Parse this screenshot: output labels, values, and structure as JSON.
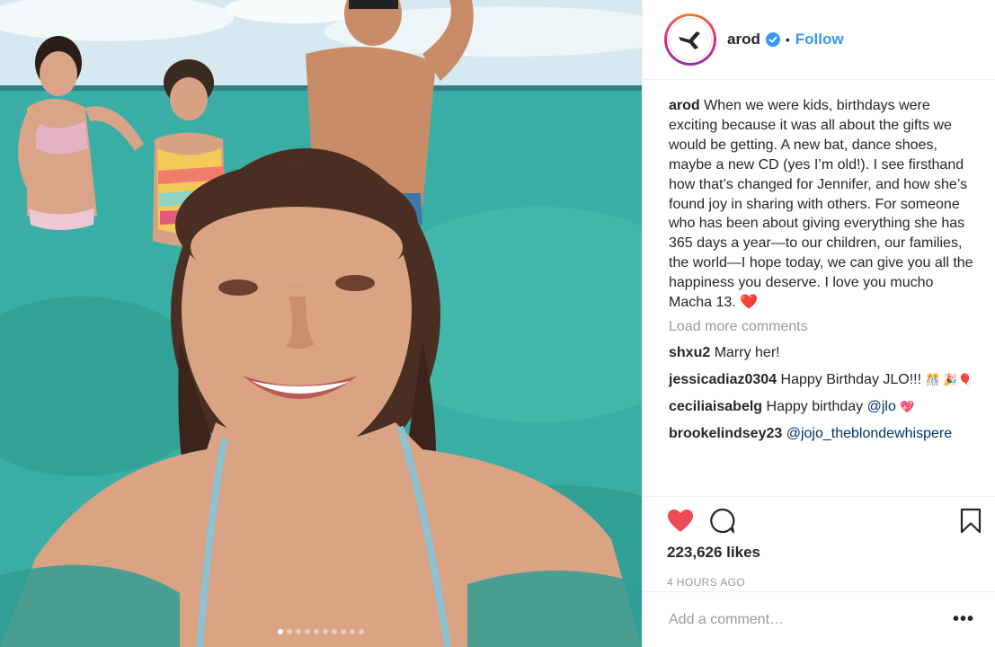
{
  "post": {
    "photo_alt": "Beach selfie photo",
    "carousel": {
      "count": 10,
      "active_index": 0
    }
  },
  "header": {
    "username": "arod",
    "separator": "•",
    "follow_label": "Follow",
    "verified": true
  },
  "caption": {
    "username": "arod",
    "text": "When we were kids, birthdays were exciting because it was all about the gifts we would be getting. A new bat, dance shoes, maybe a new CD (yes I’m old!). I see firsthand how that’s changed for Jennifer, and how she’s found joy in sharing with others. For someone who has been about giving everything she has 365 days a year—to our children, our families, the world—I hope today, we can give you all the happiness you deserve. I love you mucho Macha 13.",
    "emoji": "❤️"
  },
  "load_more_label": "Load more comments",
  "comments": [
    {
      "username": "shxu2",
      "text": "Marry her!"
    },
    {
      "username": "jessicadiaz0304",
      "text": "Happy Birthday JLO!!!",
      "emoji": "🎊 🎉🎈"
    },
    {
      "username": "ceciliaisabelg",
      "text": "Happy birthday",
      "mention": "@jlo",
      "emoji": "💖"
    },
    {
      "username": "brookelindsey23",
      "mention": "@jojo_theblondewhispere"
    }
  ],
  "likes_label": "223,626 likes",
  "timestamp": "4 HOURS AGO",
  "add_comment_placeholder": "Add a comment…",
  "more_label": "•••",
  "colors": {
    "accent": "#3897f0",
    "like_red": "#ed4956",
    "muted": "#999999"
  }
}
